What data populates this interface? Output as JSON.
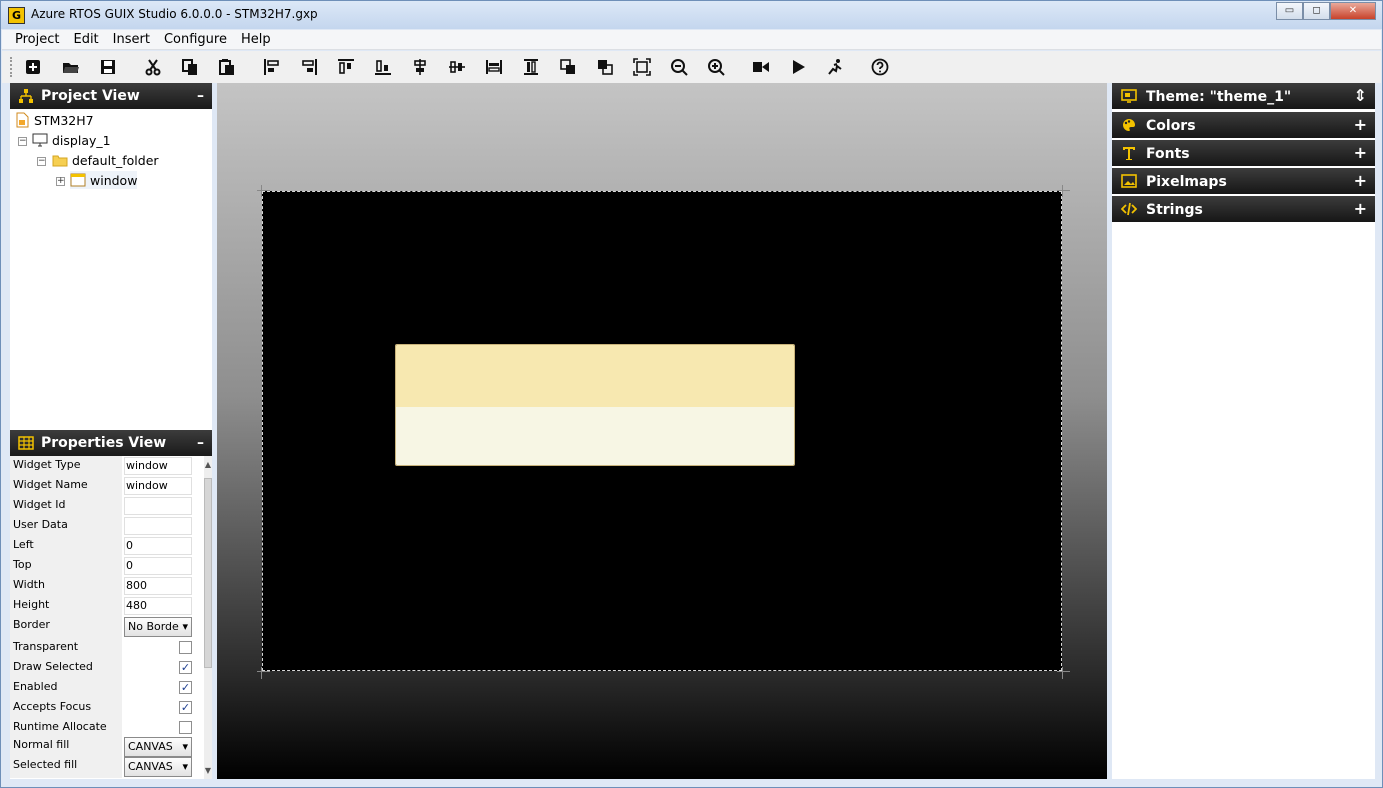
{
  "app": {
    "title": "Azure RTOS GUIX Studio 6.0.0.0 - STM32H7.gxp",
    "icon_letter": "G"
  },
  "window_controls": {
    "minimize": "▭",
    "maximize": "◻",
    "close": "✕"
  },
  "menu": [
    "Project",
    "Edit",
    "Insert",
    "Configure",
    "Help"
  ],
  "toolbar": [
    "new-project",
    "open-project",
    "save-project",
    "cut",
    "copy",
    "paste",
    "align-left",
    "align-right",
    "align-top",
    "align-bottom",
    "v-center",
    "h-center",
    "equal-width",
    "equal-height",
    "move-to-front",
    "move-to-back",
    "size-to-fit",
    "zoom-out",
    "zoom-in",
    "record-macro",
    "run",
    "run-app",
    "help"
  ],
  "project_view": {
    "title": "Project View",
    "min": "–",
    "nodes": [
      {
        "label": "STM32H7",
        "icon": "project-icon"
      },
      {
        "label": "display_1",
        "icon": "monitor-icon"
      },
      {
        "label": "default_folder",
        "icon": "folder-icon"
      },
      {
        "label": "window",
        "icon": "window-icon"
      }
    ]
  },
  "properties_view": {
    "title": "Properties View",
    "min": "–",
    "rows": [
      {
        "label": "Widget Type",
        "value": "window",
        "kind": "text"
      },
      {
        "label": "Widget Name",
        "value": "window",
        "kind": "text"
      },
      {
        "label": "Widget Id",
        "value": "",
        "kind": "text"
      },
      {
        "label": "User Data",
        "value": "",
        "kind": "text"
      },
      {
        "label": "Left",
        "value": "0",
        "kind": "text"
      },
      {
        "label": "Top",
        "value": "0",
        "kind": "text"
      },
      {
        "label": "Width",
        "value": "800",
        "kind": "text"
      },
      {
        "label": "Height",
        "value": "480",
        "kind": "text"
      },
      {
        "label": "Border",
        "value": "No Borde",
        "kind": "select"
      },
      {
        "label": "Transparent",
        "value": "",
        "kind": "check"
      },
      {
        "label": "Draw Selected",
        "value": "✓",
        "kind": "check"
      },
      {
        "label": "Enabled",
        "value": "✓",
        "kind": "check"
      },
      {
        "label": "Accepts Focus",
        "value": "✓",
        "kind": "check"
      },
      {
        "label": "Runtime Allocate",
        "value": "",
        "kind": "check"
      },
      {
        "label": "Normal fill",
        "value": "CANVAS",
        "kind": "select"
      },
      {
        "label": "Selected fill",
        "value": "CANVAS",
        "kind": "select"
      }
    ]
  },
  "resources": [
    {
      "label": "Theme: \"theme_1\"",
      "icon": "theme-icon",
      "action": "⇕"
    },
    {
      "label": "Colors",
      "icon": "palette-icon",
      "action": "+"
    },
    {
      "label": "Fonts",
      "icon": "font-icon",
      "action": "+"
    },
    {
      "label": "Pixelmaps",
      "icon": "image-icon",
      "action": "+"
    },
    {
      "label": "Strings",
      "icon": "code-icon",
      "action": "+"
    }
  ],
  "colors": {
    "accent_yellow": "#f3c200",
    "canvas": "#000000",
    "prompt_top": "#f7e8b0",
    "prompt_bottom": "#f7f6e4"
  }
}
